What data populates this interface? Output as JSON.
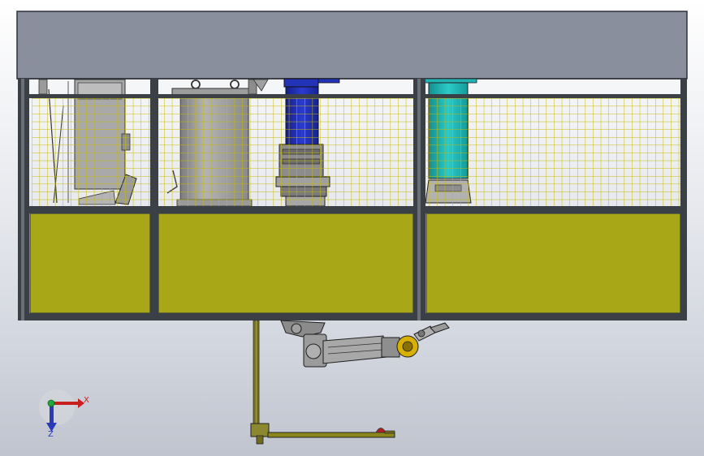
{
  "viewport": {
    "background_top": "#ffffff",
    "background_bottom": "#bfc4ce"
  },
  "colors": {
    "roof_panel": "#8a8f9e",
    "frame": "#3b3f46",
    "mesh": "#c8b800",
    "lower_panel": "#a8a718",
    "blue_component": "#2233b8",
    "teal_component": "#22b2b2",
    "tank_gray": "#9a9a9a",
    "robot_gray": "#9b9b9b",
    "robot_end_effector": "#d8b000",
    "base_rail": "#6f6a1e"
  },
  "triad": {
    "icon": "coordinate-triad-icon",
    "x_label": "X",
    "z_label": "Z",
    "x_color": "#c81e1e",
    "y_color": "#1ea83a",
    "z_color": "#2a3ab8"
  }
}
